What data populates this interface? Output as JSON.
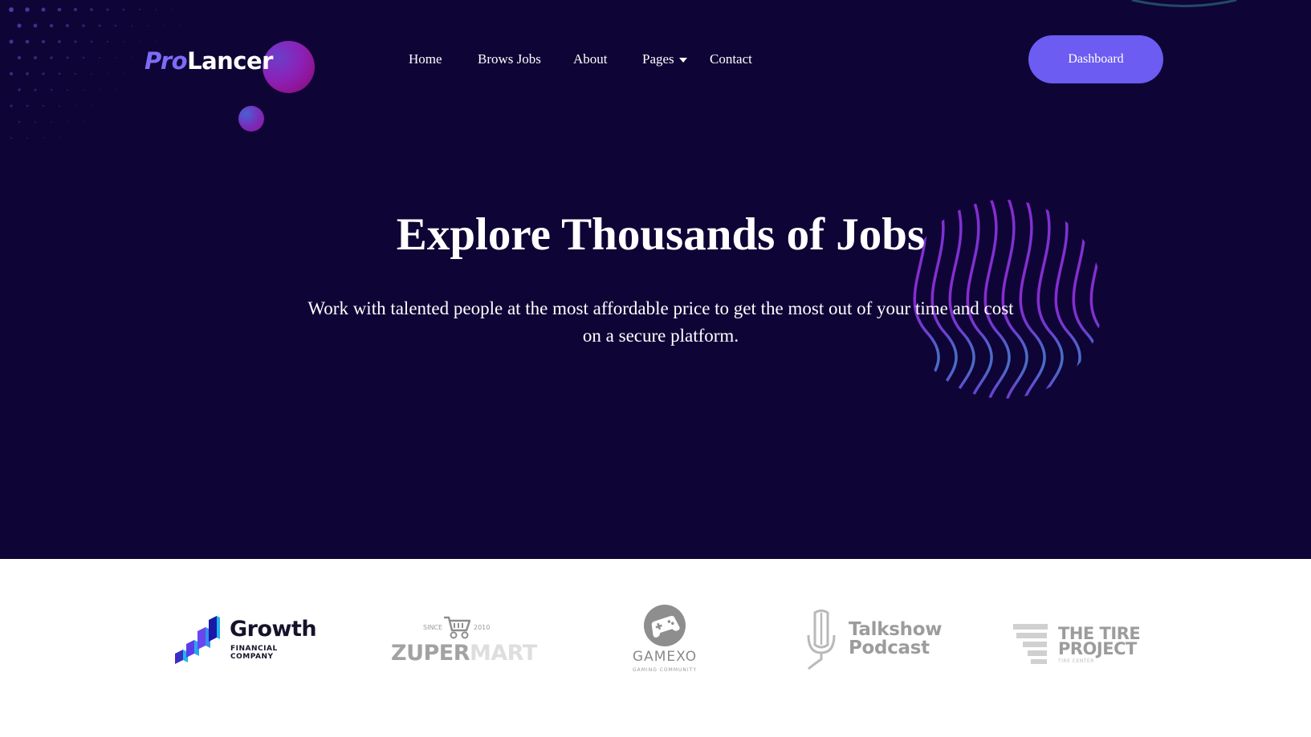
{
  "header": {
    "logo": {
      "part1": "Pro",
      "part2": "Lancer"
    },
    "nav": [
      {
        "label": "Home"
      },
      {
        "label": "Brows Jobs"
      },
      {
        "label": "About"
      },
      {
        "label": "Pages",
        "has_dropdown": true
      },
      {
        "label": "Contact"
      }
    ],
    "cta_label": "Dashboard"
  },
  "hero": {
    "title": "Explore Thousands of Jobs",
    "subtitle": "Work with talented people at the most affordable price to get the most out of your time and cost on a secure platform."
  },
  "brands": [
    {
      "name": "Growth",
      "tagline": "FINANCIAL COMPANY",
      "icon": "growth-bars-icon"
    },
    {
      "name_a": "ZUPER",
      "name_b": "MART",
      "since": "SINCE",
      "year": "2010",
      "icon": "shopping-cart-icon"
    },
    {
      "name": "GAMEXO",
      "tagline": "GAMING COMMUNITY",
      "icon": "gamepad-icon"
    },
    {
      "line1": "Talkshow",
      "line2": "Podcast",
      "icon": "microphone-icon"
    },
    {
      "line1": "THE TIRE",
      "line2": "PROJECT",
      "tagline": "TIRE CENTER",
      "icon": "tire-stripes-icon"
    }
  ],
  "colors": {
    "hero_bg": "#0f0436",
    "accent": "#6c5cf2",
    "logo_pro": "#7b6cf6",
    "brand_gray": "#9c9c9c"
  }
}
